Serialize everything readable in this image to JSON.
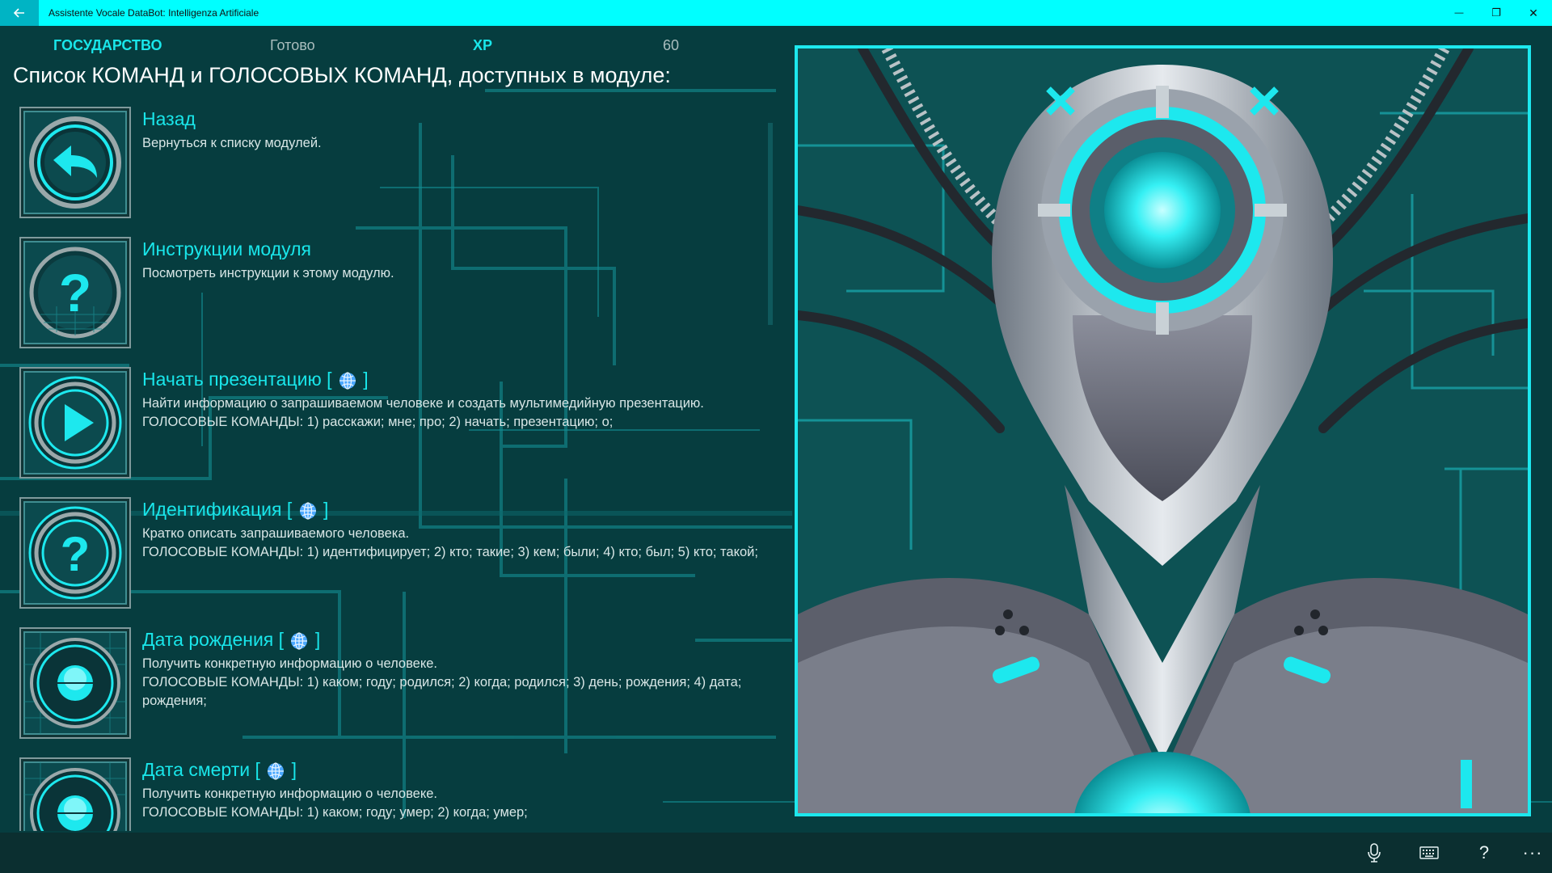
{
  "window": {
    "title": "Assistente Vocale DataBot: Intelligenza Artificiale",
    "back_icon": "arrow-left-icon",
    "minimize_glyph": "—",
    "maximize_glyph": "❐",
    "close_glyph": "✕"
  },
  "status": {
    "state_label": "ГОСУДАРСТВО",
    "state_value": "Готово",
    "xp_label": "XP",
    "xp_value": "60"
  },
  "heading": "Список КОМАНД и ГОЛОСОВЫХ КОМАНД, доступных в модуле:",
  "commands": [
    {
      "icon": "back-arrow-icon",
      "title": "Назад",
      "web": false,
      "desc": "Вернуться к списку модулей.",
      "voice": ""
    },
    {
      "icon": "question-icon",
      "title": "Инструкции модуля",
      "web": false,
      "desc": "Посмотреть инструкции к этому модулю.",
      "voice": ""
    },
    {
      "icon": "play-icon",
      "title": "Начать презентацию [",
      "title_end": "]",
      "web": true,
      "desc": "Найти информацию о запрашиваемом человеке и создать мультимедийную презентацию.",
      "voice": "ГОЛОСОВЫЕ КОМАНДЫ: 1) расскажи; мне; про; 2) начать; презентацию; о;"
    },
    {
      "icon": "question-icon",
      "title": "Идентификация [",
      "title_end": "]",
      "web": true,
      "desc": "Кратко описать запрашиваемого человека.",
      "voice": "ГОЛОСОВЫЕ КОМАНДЫ: 1) идентифицирует; 2) кто; такие; 3) кем; были; 4) кто; был; 5) кто; такой;"
    },
    {
      "icon": "orb-icon",
      "title": "Дата рождения [",
      "title_end": "]",
      "web": true,
      "desc": "Получить конкретную информацию о человеке.",
      "voice": "ГОЛОСОВЫЕ КОМАНДЫ: 1) каком; году; родился; 2) когда; родился; 3) день; рождения; 4) дата; рождения;"
    },
    {
      "icon": "orb-icon",
      "title": "Дата смерти [",
      "title_end": "]",
      "web": true,
      "desc": "Получить конкретную информацию о человеке.",
      "voice": "ГОЛОСОВЫЕ КОМАНДЫ: 1) каком; году; умер; 2) когда; умер;"
    }
  ],
  "bottom_bar": {
    "mic_icon": "microphone-icon",
    "keyboard_icon": "keyboard-icon",
    "help_glyph": "?",
    "more_glyph": "···"
  },
  "colors": {
    "accent": "#19e6ea",
    "titlebar": "#00ffff",
    "background": "#063d3f",
    "bottombar": "#0b2f30"
  }
}
